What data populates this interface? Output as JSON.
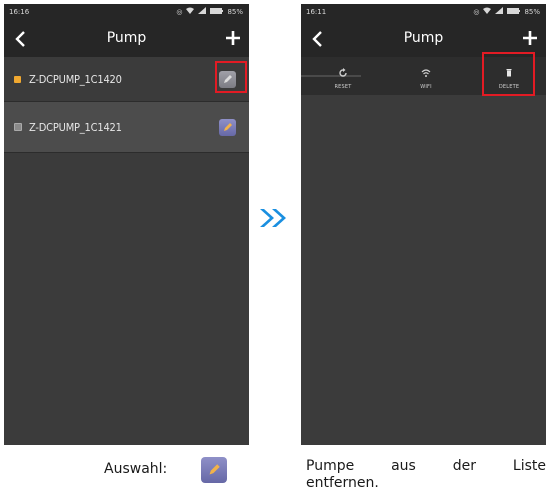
{
  "left_screen": {
    "status_time": "16:16",
    "status_battery": "85%",
    "title": "Pump",
    "devices": [
      {
        "name": "Z-DCPUMP_1C1420",
        "status_color": "#f0a830",
        "selected": false
      },
      {
        "name": "Z-DCPUMP_1C1421",
        "status_color": "#8a8a8a",
        "selected": true
      }
    ]
  },
  "right_screen": {
    "status_time": "16:11",
    "status_battery": "85%",
    "title": "Pump",
    "actions": [
      {
        "label": "RESET",
        "icon": "reset-icon"
      },
      {
        "label": "WIFI",
        "icon": "wifi-icon"
      },
      {
        "label": "DELETE",
        "icon": "trash-icon"
      }
    ]
  },
  "captions": {
    "left": "Auswahl:",
    "right": "Pumpe aus der Liste entfernen."
  },
  "colors": {
    "highlight": "#e21b24",
    "arrow": "#1a8fe0",
    "edit_button": "#7a7cb8"
  }
}
